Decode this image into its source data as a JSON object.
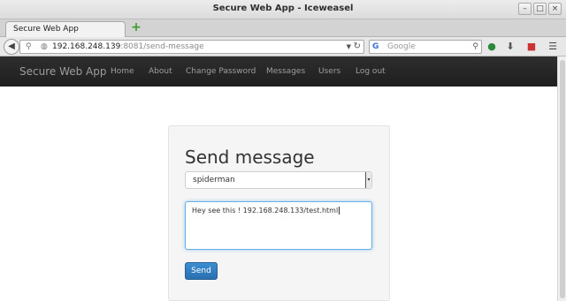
{
  "window": {
    "title": "Secure Web App - Iceweasel"
  },
  "tab": {
    "title": "Secure Web App"
  },
  "address_bar": {
    "host": "192.168.248.139",
    "rest": ":8081/send-message"
  },
  "search_bar": {
    "engine_glyph": "G",
    "placeholder": "Google"
  },
  "site_nav": {
    "brand": "Secure Web App",
    "links": [
      "Home",
      "About",
      "Change Password",
      "Messages",
      "Users",
      "Log out"
    ]
  },
  "form": {
    "heading": "Send message",
    "recipient": "spiderman",
    "message": "Hey see this ! 192.168.248.133/test.html",
    "send_label": "Send"
  },
  "colors": {
    "primary_button": "#337ab7",
    "navbar": "#222222",
    "focus_ring": "#66afe9"
  },
  "icons": [
    "back-icon",
    "search-icon",
    "globe-icon",
    "reload-icon",
    "download-icon",
    "addon-icon",
    "menu-icon"
  ]
}
